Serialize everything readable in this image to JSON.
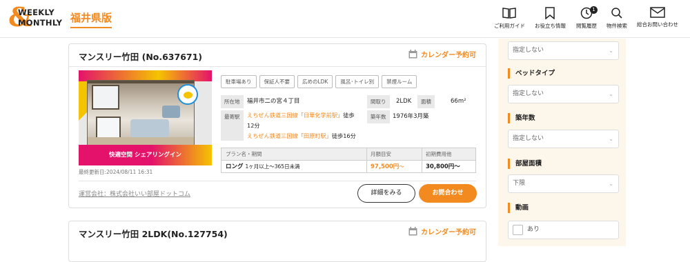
{
  "header": {
    "logo": {
      "line1": "WEEKLY",
      "line2": "MONTHLY"
    },
    "edition": "福井県版",
    "nav": [
      {
        "label": "ご利用ガイド",
        "icon": "book-icon"
      },
      {
        "label": "お役立ち情報",
        "icon": "bookmark-icon"
      },
      {
        "label": "閲覧履歴",
        "icon": "clock-icon",
        "badge": "1"
      },
      {
        "label": "物件検索",
        "icon": "search-icon"
      },
      {
        "label": "総合お問い合わせ",
        "icon": "mail-icon"
      }
    ]
  },
  "listings": [
    {
      "title": "マンスリー竹田 (No.637671)",
      "calendar": "カレンダー予約可",
      "photo_caption": "快適空間 シェアリングイン",
      "updated": "最終更新日:2024/08/11 16:31",
      "tags": [
        "駐車場あり",
        "保証人不要",
        "広めのLDK",
        "風呂･トイレ別",
        "禁煙ルーム"
      ],
      "address_label": "所在地",
      "address": "福井市二の宮４丁目",
      "layout_label": "間取り",
      "layout": "2LDK",
      "area_label": "面積",
      "area": "66m²",
      "station_label": "最寄駅",
      "station1_line": "えちぜん鉄道三国線「日華化学前駅」",
      "station1_walk": "徒歩",
      "station1_walk2": "12分",
      "station2_line": "えちぜん鉄道三国線「田原町駅」",
      "station2_walk": "徒歩16分",
      "built_label": "築年数",
      "built": "1976年3月築",
      "plan_header": "プラン名・期間",
      "rent_header": "月額目安",
      "initial_header": "初期費用他",
      "plan_name": "ロング",
      "plan_period": "1ヶ月以上～365日未満",
      "rent": "97,500円",
      "rent_suffix": "～",
      "initial": "30,800円～",
      "company": "運営会社：株式会社いい部屋ドットコム",
      "detail_button": "詳細をみる",
      "inquiry_button": "お問合わせ"
    },
    {
      "title": "マンスリー竹田 2LDK(No.127754)",
      "calendar": "カレンダー予約可"
    }
  ],
  "sidebar": {
    "select_top": "指定しない",
    "bed_heading": "ベッドタイプ",
    "bed_select": "指定しない",
    "age_heading": "築年数",
    "age_select": "指定しない",
    "area_heading": "部屋面積",
    "area_select": "下限",
    "video_heading": "動画",
    "video_option": "あり"
  },
  "colors": {
    "accent": "#f38a1f",
    "sidebar_bg": "#fdf6ea"
  }
}
